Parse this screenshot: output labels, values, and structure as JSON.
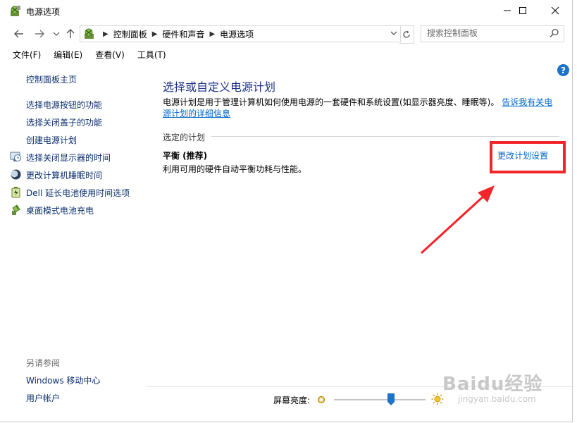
{
  "window": {
    "title": "电源选项"
  },
  "address": {
    "crumbs": [
      "控制面板",
      "硬件和声音",
      "电源选项"
    ]
  },
  "search": {
    "placeholder": "搜索控制面板"
  },
  "menu": [
    "文件(F)",
    "编辑(E)",
    "查看(V)",
    "工具(T)"
  ],
  "sidebar": {
    "home": "控制面板主页",
    "links": [
      {
        "label": "选择电源按钮的功能",
        "icon": ""
      },
      {
        "label": "选择关闭盖子的功能",
        "icon": ""
      },
      {
        "label": "创建电源计划",
        "icon": ""
      },
      {
        "label": "选择关闭显示器的时间",
        "icon": "monitor-clock-icon"
      },
      {
        "label": "更改计算机睡眠时间",
        "icon": "moon-icon"
      },
      {
        "label": "Dell 延长电池使用时间选项",
        "icon": "dell-battery-icon"
      },
      {
        "label": "桌面模式电池充电",
        "icon": "battery-charge-icon"
      }
    ],
    "see_also": "另请参阅",
    "see_also_links": [
      "Windows 移动中心",
      "用户帐户"
    ]
  },
  "main": {
    "title": "选择或自定义电源计划",
    "desc_text": "电源计划是用于管理计算机如何使用电源的一套硬件和系统设置(如显示器亮度、睡眠等)。",
    "desc_link": "告诉我有关电源计划的详细信息",
    "section_label": "选定的计划",
    "plan_name": "平衡 (推荐)",
    "plan_desc": "利用可用的硬件自动平衡功耗与性能。",
    "change_link": "更改计划设置"
  },
  "brightness": {
    "label": "屏幕亮度:",
    "level_percent": 62
  },
  "watermark": {
    "main": "Baidu经验",
    "sub": "jingyan.baidu.com"
  },
  "colors": {
    "link": "#0066cc",
    "title": "#1e3287",
    "highlight": "#f3242a"
  }
}
